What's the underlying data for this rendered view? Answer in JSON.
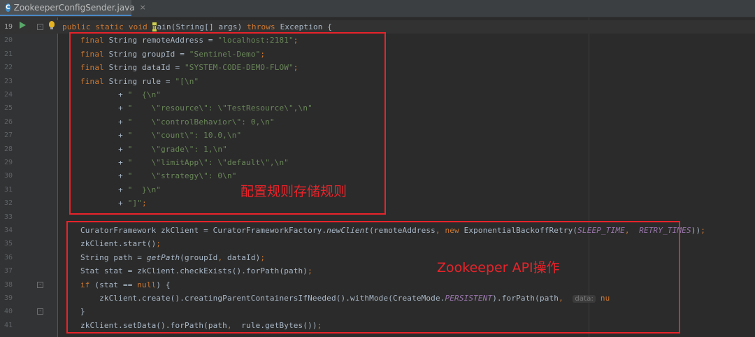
{
  "tab": {
    "icon_letter": "C",
    "label": "ZookeeperConfigSender.java",
    "close": "×"
  },
  "lines": [
    {
      "num": "19",
      "segments": [
        [
          "kw",
          "public static void "
        ],
        [
          "caret",
          "m"
        ],
        [
          "",
          "ain(String[] args) "
        ],
        [
          "kw",
          "throws "
        ],
        [
          "",
          "Exception {"
        ]
      ]
    },
    {
      "num": "20",
      "segments": [
        [
          "kw",
          "final "
        ],
        [
          "",
          "String remoteAddress = "
        ],
        [
          "str",
          "\"localhost:2181\""
        ],
        [
          "kw",
          ";"
        ]
      ]
    },
    {
      "num": "21",
      "segments": [
        [
          "kw",
          "final "
        ],
        [
          "",
          "String groupId = "
        ],
        [
          "str",
          "\"Sentinel-Demo\""
        ],
        [
          "kw",
          ";"
        ]
      ]
    },
    {
      "num": "22",
      "segments": [
        [
          "kw",
          "final "
        ],
        [
          "",
          "String dataId = "
        ],
        [
          "str",
          "\"SYSTEM-CODE-DEMO-FLOW\""
        ],
        [
          "kw",
          ";"
        ]
      ]
    },
    {
      "num": "23",
      "segments": [
        [
          "kw",
          "final "
        ],
        [
          "",
          "String rule = "
        ],
        [
          "str",
          "\"[\\n\""
        ]
      ]
    },
    {
      "num": "24",
      "segments": [
        [
          "",
          "        + "
        ],
        [
          "str",
          "\"  {\\n\""
        ]
      ]
    },
    {
      "num": "25",
      "segments": [
        [
          "",
          "        + "
        ],
        [
          "str",
          "\"    \\\"resource\\\": \\\"TestResource\\\",\\n\""
        ]
      ]
    },
    {
      "num": "26",
      "segments": [
        [
          "",
          "        + "
        ],
        [
          "str",
          "\"    \\\"controlBehavior\\\": 0,\\n\""
        ]
      ]
    },
    {
      "num": "27",
      "segments": [
        [
          "",
          "        + "
        ],
        [
          "str",
          "\"    \\\"count\\\": 10.0,\\n\""
        ]
      ]
    },
    {
      "num": "28",
      "segments": [
        [
          "",
          "        + "
        ],
        [
          "str",
          "\"    \\\"grade\\\": 1,\\n\""
        ]
      ]
    },
    {
      "num": "29",
      "segments": [
        [
          "",
          "        + "
        ],
        [
          "str",
          "\"    \\\"limitApp\\\": \\\"default\\\",\\n\""
        ]
      ]
    },
    {
      "num": "30",
      "segments": [
        [
          "",
          "        + "
        ],
        [
          "str",
          "\"    \\\"strategy\\\": 0\\n\""
        ]
      ]
    },
    {
      "num": "31",
      "segments": [
        [
          "",
          "        + "
        ],
        [
          "str",
          "\"  }\\n\""
        ]
      ]
    },
    {
      "num": "32",
      "segments": [
        [
          "",
          "        + "
        ],
        [
          "str",
          "\"]\""
        ],
        [
          "kw",
          ";"
        ]
      ]
    },
    {
      "num": "33",
      "segments": []
    },
    {
      "num": "34",
      "segments": [
        [
          "",
          "CuratorFramework zkClient = CuratorFrameworkFactory."
        ],
        [
          "fn-it",
          "newClient"
        ],
        [
          "",
          "(remoteAddress"
        ],
        [
          "kw",
          ", new "
        ],
        [
          "",
          "ExponentialBackoffRetry("
        ],
        [
          "const",
          "SLEEP_TIME"
        ],
        [
          "kw",
          ",  "
        ],
        [
          "const",
          "RETRY_TIMES"
        ],
        [
          "",
          "))"
        ],
        [
          "kw",
          ";"
        ]
      ]
    },
    {
      "num": "35",
      "segments": [
        [
          "",
          "zkClient.start()"
        ],
        [
          "kw",
          ";"
        ]
      ]
    },
    {
      "num": "36",
      "segments": [
        [
          "",
          "String path = "
        ],
        [
          "fn-it",
          "getPath"
        ],
        [
          "",
          "(groupId"
        ],
        [
          "kw",
          ", "
        ],
        [
          "",
          "dataId)"
        ],
        [
          "kw",
          ";"
        ]
      ]
    },
    {
      "num": "37",
      "segments": [
        [
          "",
          "Stat stat = zkClient.checkExists().forPath(path)"
        ],
        [
          "kw",
          ";"
        ]
      ]
    },
    {
      "num": "38",
      "segments": [
        [
          "kw",
          "if "
        ],
        [
          "",
          "(stat == "
        ],
        [
          "kw",
          "null"
        ],
        [
          "",
          ") {"
        ]
      ]
    },
    {
      "num": "39",
      "segments": [
        [
          "",
          "    zkClient.create().creatingParentContainersIfNeeded().withMode(CreateMode."
        ],
        [
          "const",
          "PERSISTENT"
        ],
        [
          "",
          ").forPath(path"
        ],
        [
          "kw",
          ",  "
        ],
        [
          "hint",
          "data:"
        ],
        [
          "kw",
          " nu"
        ]
      ]
    },
    {
      "num": "40",
      "segments": [
        [
          "",
          "}"
        ]
      ]
    },
    {
      "num": "41",
      "segments": [
        [
          "",
          "zkClient.setData().forPath(path"
        ],
        [
          "kw",
          ",  "
        ],
        [
          "",
          "rule.getBytes())"
        ],
        [
          "kw",
          ";"
        ]
      ]
    }
  ],
  "annotations": {
    "rule_storage": "配置规则存储规则",
    "zookeeper_api": "Zookeeper API操作"
  },
  "colors": {
    "annotation_red": "#e8232a",
    "keyword": "#cc7832",
    "string": "#6a8759",
    "constant": "#9876aa"
  }
}
